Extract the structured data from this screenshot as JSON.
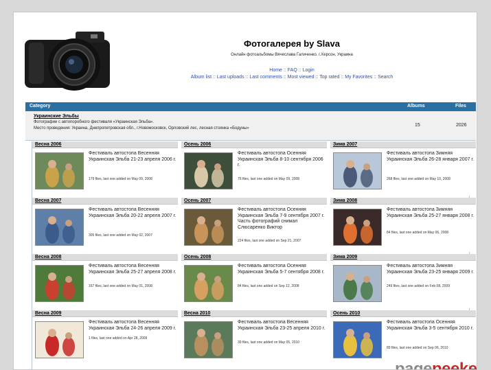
{
  "site": {
    "title": "Фотогалерея by Slava",
    "subtitle": "Онлайн фотоальбомы Вячеслава Галиченко. г.Херсон, Украина"
  },
  "nav": {
    "top": [
      "Home",
      "FAQ",
      "Login"
    ],
    "bottom": [
      "Album list",
      "Last uploads",
      "Last comments",
      "Most viewed",
      "Top rated",
      "My Favorites",
      "Search"
    ],
    "separator": "::"
  },
  "category_table": {
    "headers": {
      "category": "Category",
      "albums": "Albums",
      "files": "Files"
    },
    "row": {
      "name": "Украинские Эльбы",
      "desc1": "Фотографии с автопоробного фестиваля «Украинская Эльба».",
      "desc2": "Место проведения: Украина, Днепропетровская обл., г.Новомосковск, Орловский лес, лесная стоянка «Бодуны»",
      "albums": "15",
      "files": "2026"
    }
  },
  "albums": [
    [
      {
        "title": "Весна 2006",
        "desc": "Фестиваль автостопа Весенняя Украинская Эльба 21-23 апреля 2006 г.",
        "meta": "179 files, last one added on May 09, 2008"
      },
      {
        "title": "Осень 2006",
        "desc": "Фестиваль автостопа Осенняя Украинская Эльба 8-10 сентября 2006 г.",
        "meta": "75 files, last one added on May 09, 2008"
      },
      {
        "title": "Зима 2007",
        "desc": "Фестиваль автостопа Зимняя Украинская Эльба 26-28 января 2007 г.",
        "meta": "268 files, last one added on May 10, 2008"
      }
    ],
    [
      {
        "title": "Весна 2007",
        "desc": "Фестиваль автостопа Весенняя Украинская Эльба 20-22 апреля 2007 г.",
        "meta": "305 files, last one added on May 02, 2007"
      },
      {
        "title": "Осень 2007",
        "desc": "Фестиваль автостопа Осенняя Украинская Эльба 7-9 сентября 2007 г. Часть фотографий снимал Слюсаренко Виктор",
        "meta": "224 files, last one added on Sep 21, 2007"
      },
      {
        "title": "Зима 2008",
        "desc": "Фестиваль автостопа Зимняя Украинская Эльба 25-27 января 2008 г.",
        "meta": "84 files, last one added on May 06, 2008"
      }
    ],
    [
      {
        "title": "Весна 2008",
        "desc": "Фестиваль автостопа Весенняя Украинская Эльба 25-27 апреля 2008 г.",
        "meta": "167 files, last one added on May 01, 2008"
      },
      {
        "title": "Осень 2008",
        "desc": "Фестиваль автостопа Осенняя Украинская Эльба 5-7 сентября 2008 г.",
        "meta": "84 files, last one added on Sep 12, 2008"
      },
      {
        "title": "Зима 2009",
        "desc": "Фестиваль автостопа Зимняя Украинская Эльба 23-25 января 2009 г.",
        "meta": "249 files, last one added on Feb 08, 2009"
      }
    ],
    [
      {
        "title": "Весна 2009",
        "desc": "Фестиваль автостопа Весенняя Украинская Эльба 24-26 апреля 2009 г.",
        "meta": "1 files, last one added on Apr 28, 2009"
      },
      {
        "title": "Весна 2010",
        "desc": "Фестиваль автостопа Весенняя Украинская Эльба 23-25 апреля 2010 г.",
        "meta": "39 files, last one added on May 05, 2010"
      },
      {
        "title": "Осень 2010",
        "desc": "Фестиваль автостопа Осенняя Украинская Эльба 3-5 сентября 2010 г.",
        "meta": "89 files, last one added on Sep 06, 2010"
      }
    ]
  ],
  "thumbs": [
    [
      {
        "icon": "two-people-photo",
        "sky": "#6e8a5a",
        "fg": "#c9a24a"
      },
      {
        "icon": "dog-photo",
        "sky": "#3d4e3a",
        "fg": "#d8c8a8"
      },
      {
        "icon": "snow-camp-photo",
        "sky": "#b8c8d8",
        "fg": "#4a5a78"
      }
    ],
    [
      {
        "icon": "people-group-photo",
        "sky": "#5e7fa8",
        "fg": "#3a5b8c"
      },
      {
        "icon": "roasted-meat-photo",
        "sky": "#6a5a3a",
        "fg": "#c8945a"
      },
      {
        "icon": "campfire-photo",
        "sky": "#3a2a2a",
        "fg": "#e07030"
      }
    ],
    [
      {
        "icon": "forest-people-photo",
        "sky": "#4e7a3a",
        "fg": "#c84030"
      },
      {
        "icon": "crowd-photo",
        "sky": "#6a8a4a",
        "fg": "#d8a060"
      },
      {
        "icon": "winter-people-photo",
        "sky": "#a8b8c8",
        "fg": "#4a7a4a"
      }
    ],
    [
      {
        "icon": "magazine-cover-photo",
        "sky": "#f0e8d8",
        "fg": "#c82828"
      },
      {
        "icon": "camp-photo",
        "sky": "#5a7a5a",
        "fg": "#b89060"
      },
      {
        "icon": "blue-tent-photo",
        "sky": "#3a6ab8",
        "fg": "#e8c040"
      }
    ]
  ],
  "watermark": {
    "left": "page",
    "right": "peeker"
  }
}
